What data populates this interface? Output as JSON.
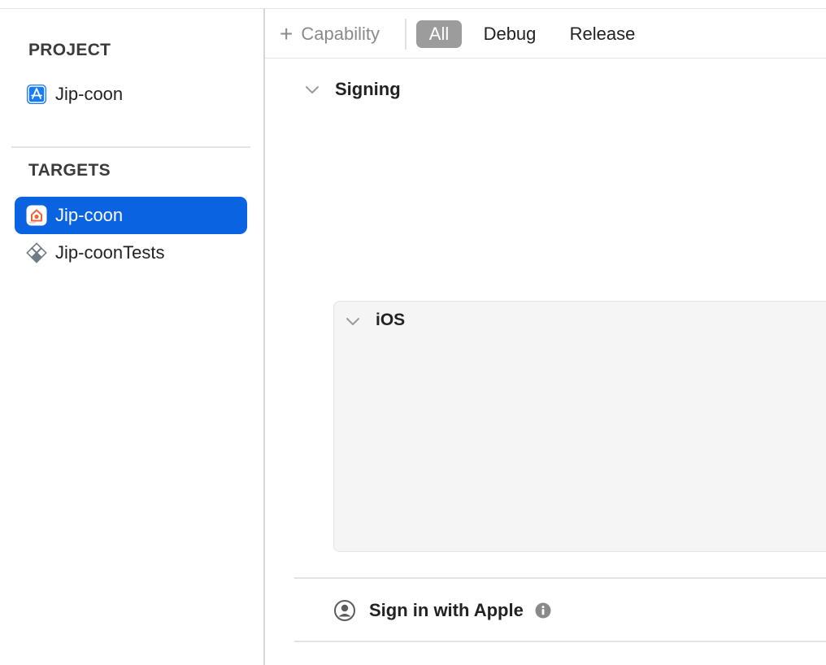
{
  "sidebar": {
    "project_header": "PROJECT",
    "project_items": [
      {
        "label": "Jip-coon",
        "icon": "app-store-icon"
      }
    ],
    "targets_header": "TARGETS",
    "target_items": [
      {
        "label": "Jip-coon",
        "icon": "app-target-icon",
        "selected": true
      },
      {
        "label": "Jip-coonTests",
        "icon": "test-target-icon",
        "selected": false
      }
    ]
  },
  "toolbar": {
    "capability_label": "Capability",
    "segments": [
      "All",
      "Debug",
      "Release"
    ],
    "selected_segment": "All"
  },
  "content": {
    "signing_title": "Signing",
    "ios_title": "iOS",
    "capabilities": [
      {
        "label": "Sign in with Apple",
        "icon": "person-circle-icon",
        "info_icon": "info-icon"
      }
    ]
  },
  "colors": {
    "accent": "#0a63e0",
    "segment_active": "#9c9c9c",
    "app_icon_orange": "#f0643c"
  }
}
